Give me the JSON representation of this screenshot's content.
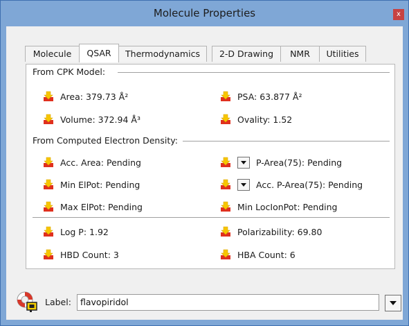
{
  "window": {
    "title": "Molecule Properties",
    "close_glyph": "x"
  },
  "tabs": [
    {
      "label": "Molecule",
      "active": false
    },
    {
      "label": "QSAR",
      "active": true
    },
    {
      "label": "Thermodynamics",
      "active": false
    },
    {
      "label": "2-D Drawing",
      "active": false
    },
    {
      "label": "NMR",
      "active": false
    },
    {
      "label": "Utilities",
      "active": false
    }
  ],
  "sections": {
    "cpk": "From CPK Model:",
    "density": "From Computed Electron Density:"
  },
  "properties": {
    "area": "Area: 379.73 Å²",
    "psa": "PSA: 63.877 Å²",
    "volume": "Volume: 372.94 Å³",
    "ovality": "Ovality: 1.52",
    "acc_area": "Acc. Area: Pending",
    "p_area": "P-Area(75): Pending",
    "min_elpot": "Min ElPot: Pending",
    "acc_p_area": "Acc. P-Area(75): Pending",
    "max_elpot": "Max ElPot: Pending",
    "min_locionpot": "Min LocIonPot: Pending",
    "log_p": "Log P: 1.92",
    "polarizability": "Polarizability: 69.80",
    "hbd_count": "HBD Count: 3",
    "hba_count": "HBA Count: 6"
  },
  "label_field": {
    "caption": "Label:",
    "value": "flavopiridol"
  },
  "icons": {
    "property": "export-arrow-icon",
    "help": "lifebuoy-icon",
    "dropdown": "chevron-down-icon"
  },
  "colors": {
    "titlebar": "#7fa7d6",
    "close": "#c74242",
    "arrow_yellow": "#f7c600",
    "arrow_red": "#e0301e"
  }
}
